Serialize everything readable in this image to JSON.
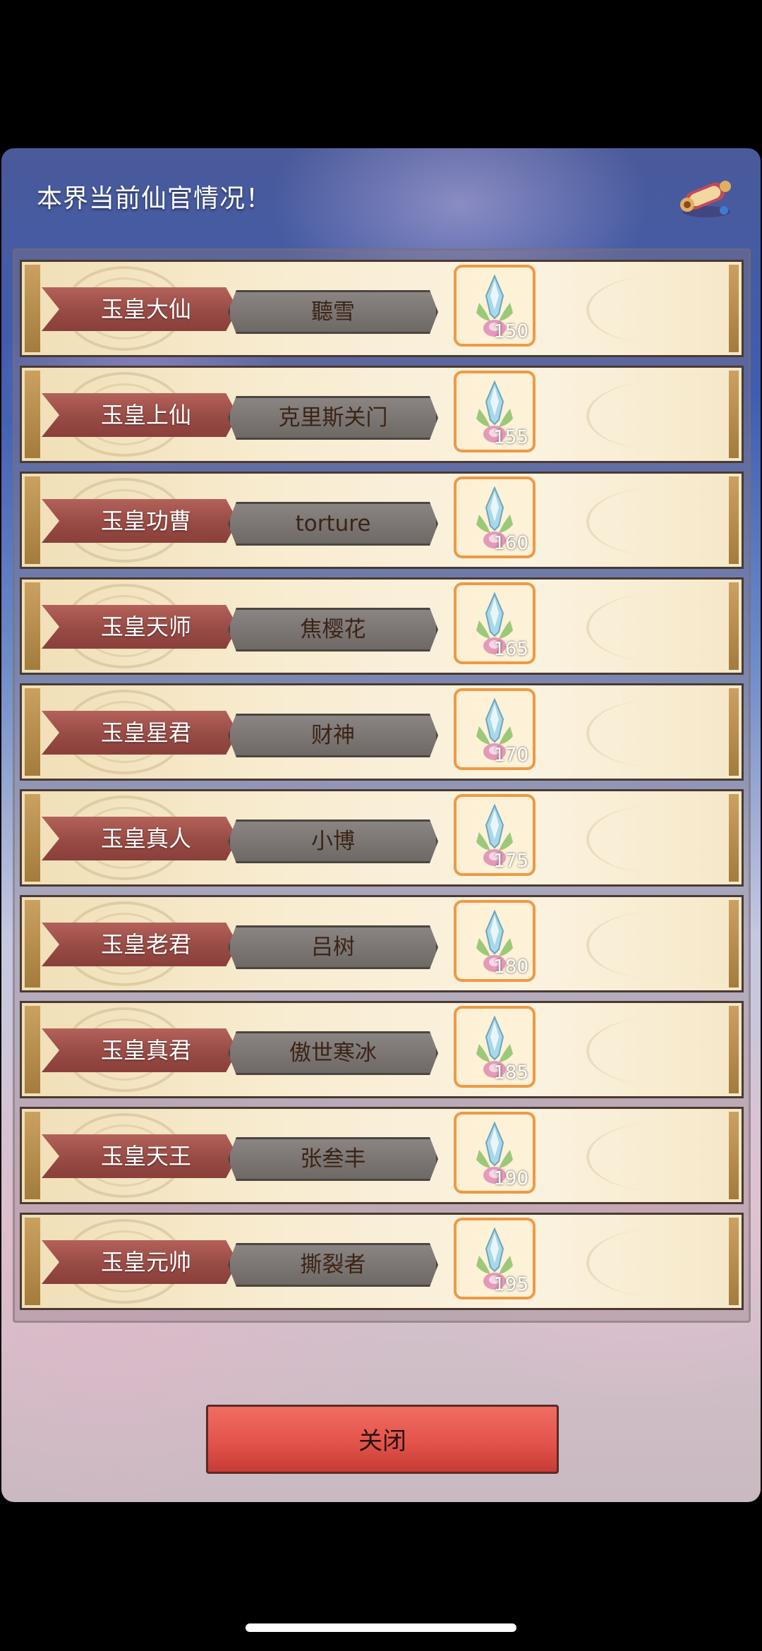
{
  "header": {
    "title": "本界当前仙官情况！",
    "scroll_icon": "scroll-icon"
  },
  "ranks": [
    {
      "title": "玉皇大仙",
      "player": "聽雪",
      "item_icon": "feather-gem-icon",
      "level": "150"
    },
    {
      "title": "玉皇上仙",
      "player": "克里斯关门",
      "item_icon": "feather-gem-icon",
      "level": "155"
    },
    {
      "title": "玉皇功曹",
      "player": "torture",
      "item_icon": "feather-gem-icon",
      "level": "160"
    },
    {
      "title": "玉皇天师",
      "player": "焦樱花",
      "item_icon": "feather-gem-icon",
      "level": "165"
    },
    {
      "title": "玉皇星君",
      "player": "财神",
      "item_icon": "feather-gem-icon",
      "level": "170"
    },
    {
      "title": "玉皇真人",
      "player": "小博",
      "item_icon": "feather-gem-icon",
      "level": "175"
    },
    {
      "title": "玉皇老君",
      "player": "吕树",
      "item_icon": "feather-gem-icon",
      "level": "180"
    },
    {
      "title": "玉皇真君",
      "player": "傲世寒冰",
      "item_icon": "feather-gem-icon",
      "level": "185"
    },
    {
      "title": "玉皇天王",
      "player": "张叁丰",
      "item_icon": "feather-gem-icon",
      "level": "190"
    },
    {
      "title": "玉皇元帅",
      "player": "撕裂者",
      "item_icon": "feather-gem-icon",
      "level": "195"
    }
  ],
  "footer": {
    "close_label": "关闭"
  },
  "colors": {
    "banner": "#9a4c46",
    "name_box": "#7a7470",
    "slot_border": "#ee9a46",
    "close_button": "#e3544b"
  }
}
